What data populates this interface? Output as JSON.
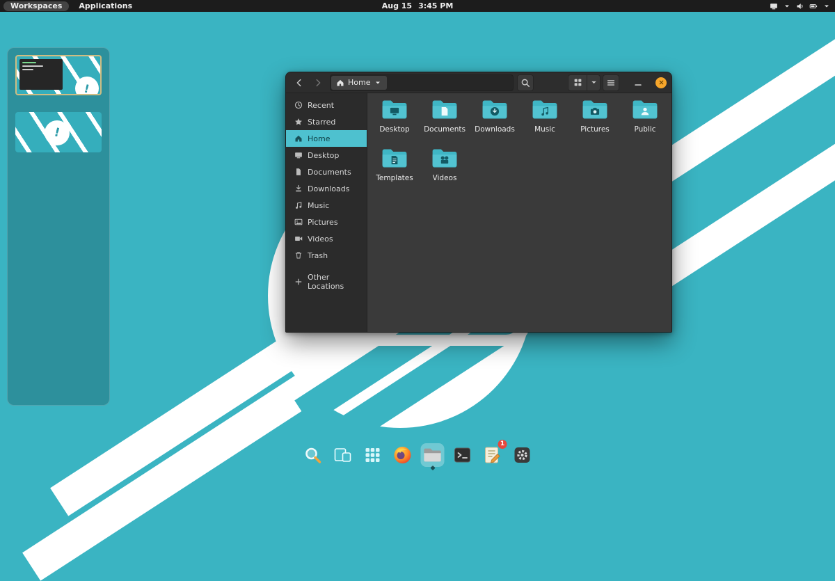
{
  "topbar": {
    "workspaces_label": "Workspaces",
    "applications_label": "Applications",
    "date": "Aug 15",
    "time": "3:45 PM",
    "tray_icons": [
      "display",
      "caret-down",
      "volume",
      "battery",
      "caret-down"
    ]
  },
  "window": {
    "location_label": "Home",
    "sidebar_items": [
      {
        "label": "Recent",
        "icon": "clock",
        "selected": false
      },
      {
        "label": "Starred",
        "icon": "star",
        "selected": false
      },
      {
        "label": "Home",
        "icon": "home",
        "selected": true
      },
      {
        "label": "Desktop",
        "icon": "monitor",
        "selected": false
      },
      {
        "label": "Documents",
        "icon": "document",
        "selected": false
      },
      {
        "label": "Downloads",
        "icon": "download",
        "selected": false
      },
      {
        "label": "Music",
        "icon": "music",
        "selected": false
      },
      {
        "label": "Pictures",
        "icon": "picture",
        "selected": false
      },
      {
        "label": "Videos",
        "icon": "video",
        "selected": false
      },
      {
        "label": "Trash",
        "icon": "trash",
        "selected": false
      }
    ],
    "other_locations_label": "Other Locations",
    "files": [
      {
        "name": "Desktop",
        "emblem": "monitor"
      },
      {
        "name": "Documents",
        "emblem": "document"
      },
      {
        "name": "Downloads",
        "emblem": "download"
      },
      {
        "name": "Music",
        "emblem": "music"
      },
      {
        "name": "Pictures",
        "emblem": "camera"
      },
      {
        "name": "Public",
        "emblem": "person"
      },
      {
        "name": "Templates",
        "emblem": "template"
      },
      {
        "name": "Videos",
        "emblem": "film"
      }
    ]
  },
  "dock_items": [
    {
      "name": "pop-shop",
      "active": false
    },
    {
      "name": "workspaces-overview",
      "active": false
    },
    {
      "name": "applications-grid",
      "active": false
    },
    {
      "name": "firefox",
      "active": false
    },
    {
      "name": "files",
      "active": true
    },
    {
      "name": "terminal",
      "active": false
    },
    {
      "name": "text-editor",
      "active": false,
      "badge": "1"
    },
    {
      "name": "settings",
      "active": false
    }
  ],
  "workspaces_panel": {
    "count": 2,
    "active_index": 0
  },
  "colors": {
    "desktop_teal": "#3ab4c2",
    "accent_cyan": "#4ec1cf",
    "close_button_orange": "#f7a62b",
    "badge_red": "#e6473d",
    "active_workspace_border": "#cfbd82"
  }
}
